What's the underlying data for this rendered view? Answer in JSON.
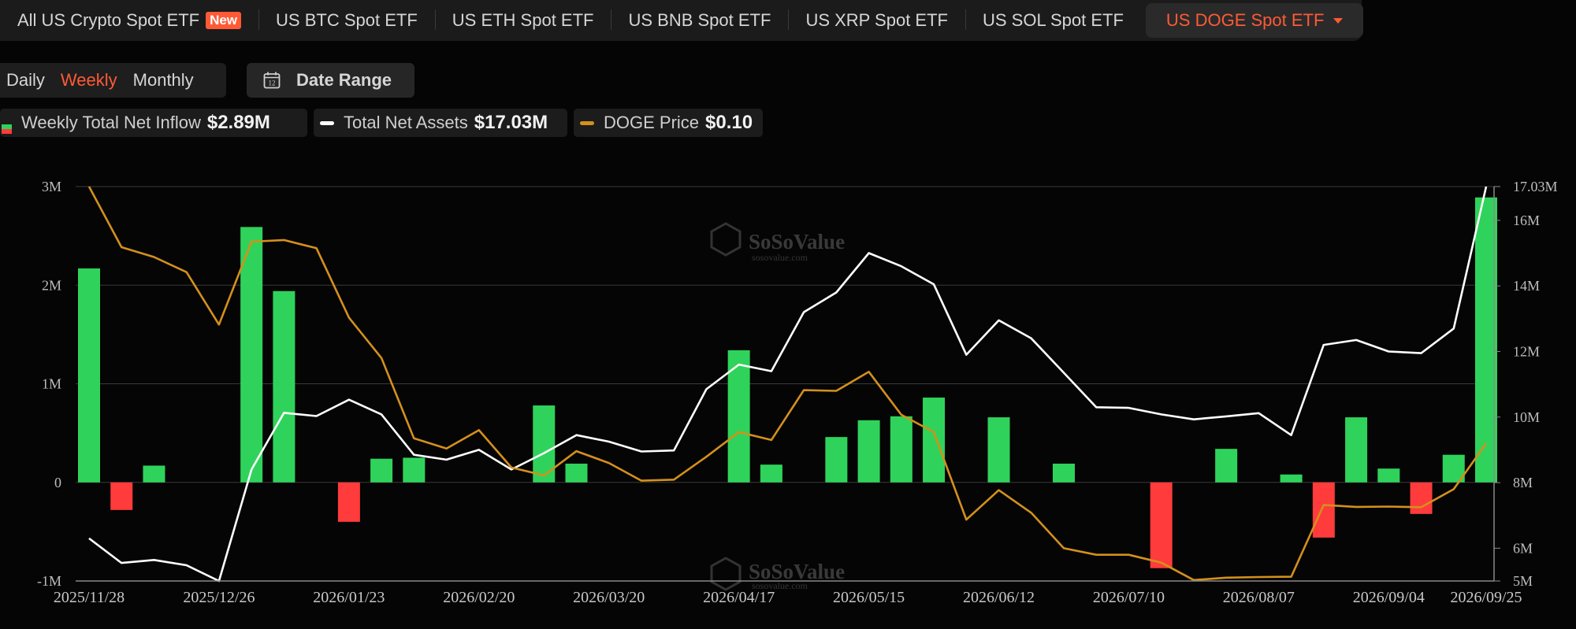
{
  "tabs": [
    {
      "label": "All US Crypto Spot ETF",
      "badge": "New"
    },
    {
      "label": "US BTC Spot ETF"
    },
    {
      "label": "US ETH Spot ETF"
    },
    {
      "label": "US BNB Spot ETF"
    },
    {
      "label": "US XRP Spot ETF"
    },
    {
      "label": "US SOL Spot ETF"
    },
    {
      "label": "US DOGE Spot ETF",
      "active": true
    }
  ],
  "period": {
    "daily": "Daily",
    "weekly": "Weekly",
    "monthly": "Monthly",
    "selected": "Weekly"
  },
  "date_range": {
    "label": "Date Range",
    "icon_text": "12"
  },
  "legend": {
    "inflow": {
      "label": "Weekly Total Net Inflow",
      "value": "$2.89M"
    },
    "assets": {
      "label": "Total Net Assets",
      "value": "$17.03M"
    },
    "price": {
      "label": "DOGE Price",
      "value": "$0.10"
    }
  },
  "watermark": {
    "brand": "SoSoValue",
    "url": "sosovalue.com"
  },
  "colors": {
    "positive": "#2fd35b",
    "negative": "#ff3b3b",
    "assets_line": "#ffffff",
    "price_line": "#d4901c",
    "accent": "#ff5a36"
  },
  "chart_data": {
    "type": "bar",
    "x_tick_labels": [
      "2025/11/28",
      "2025/12/26",
      "2026/01/23",
      "2026/02/20",
      "2026/03/20",
      "2026/04/17",
      "2026/05/15",
      "2026/06/12",
      "2026/07/10",
      "2026/08/07",
      "2026/09/04",
      "2026/09/25"
    ],
    "x": [
      "2025/11/28",
      "2025/12/05",
      "2025/12/12",
      "2025/12/19",
      "2025/12/26",
      "2026/01/02",
      "2026/01/09",
      "2026/01/16",
      "2026/01/23",
      "2026/01/30",
      "2026/02/06",
      "2026/02/13",
      "2026/02/20",
      "2026/02/27",
      "2026/03/06",
      "2026/03/13",
      "2026/03/20",
      "2026/03/27",
      "2026/04/03",
      "2026/04/10",
      "2026/04/17",
      "2026/04/24",
      "2026/05/01",
      "2026/05/08",
      "2026/05/15",
      "2026/05/22",
      "2026/05/29",
      "2026/06/05",
      "2026/06/12",
      "2026/06/19",
      "2026/06/26",
      "2026/07/03",
      "2026/07/10",
      "2026/07/17",
      "2026/07/24",
      "2026/07/31",
      "2026/08/07",
      "2026/08/14",
      "2026/08/21",
      "2026/08/28",
      "2026/09/04",
      "2026/09/11",
      "2026/09/18",
      "2026/09/25"
    ],
    "ylim_left": [
      -1000000,
      3000000
    ],
    "left_ticks": [
      {
        "v": 3000000,
        "label": "3M"
      },
      {
        "v": 2000000,
        "label": "2M"
      },
      {
        "v": 1000000,
        "label": "1M"
      },
      {
        "v": 0,
        "label": "0"
      },
      {
        "v": -1000000,
        "label": "-1M"
      }
    ],
    "ylim_right": [
      5000000,
      17030000
    ],
    "right_ticks": [
      {
        "v": 17030000,
        "label": "17.03M"
      },
      {
        "v": 16000000,
        "label": "16M"
      },
      {
        "v": 14000000,
        "label": "14M"
      },
      {
        "v": 12000000,
        "label": "12M"
      },
      {
        "v": 10000000,
        "label": "10M"
      },
      {
        "v": 8000000,
        "label": "8M"
      },
      {
        "v": 6000000,
        "label": "6M"
      },
      {
        "v": 5000000,
        "label": "5M"
      }
    ],
    "grid": true,
    "series": [
      {
        "name": "Weekly Total Net Inflow",
        "kind": "bar",
        "axis": "left",
        "values": [
          2170000,
          -280000,
          170000,
          0,
          0,
          2590000,
          1940000,
          0,
          -400000,
          240000,
          250000,
          0,
          0,
          0,
          780000,
          190000,
          0,
          0,
          0,
          0,
          1340000,
          180000,
          0,
          460000,
          630000,
          670000,
          860000,
          0,
          660000,
          0,
          190000,
          0,
          0,
          -870000,
          0,
          340000,
          0,
          80000,
          -560000,
          660000,
          140000,
          -320000,
          280000,
          2890000
        ]
      },
      {
        "name": "Total Net Assets",
        "kind": "line",
        "axis": "right",
        "values": [
          6300000,
          5550000,
          5640000,
          5480000,
          5000000,
          8400000,
          10130000,
          10030000,
          10530000,
          10080000,
          8850000,
          8700000,
          9000000,
          8400000,
          8900000,
          9450000,
          9250000,
          8950000,
          8980000,
          10850000,
          11600000,
          11400000,
          13200000,
          13800000,
          15000000,
          14600000,
          14050000,
          11900000,
          12950000,
          12400000,
          11350000,
          10300000,
          10280000,
          10080000,
          9930000,
          10020000,
          10120000,
          9450000,
          12200000,
          12350000,
          12000000,
          11950000,
          12700000,
          17030000
        ]
      },
      {
        "name": "DOGE Price",
        "kind": "line",
        "axis": "right",
        "values": [
          17030000,
          15180000,
          14880000,
          14420000,
          12820000,
          15350000,
          15400000,
          15150000,
          13030000,
          11800000,
          9350000,
          9040000,
          9600000,
          8460000,
          8220000,
          8960000,
          8600000,
          8060000,
          8090000,
          8790000,
          9540000,
          9300000,
          10820000,
          10800000,
          11380000,
          10070000,
          9540000,
          6870000,
          7770000,
          7080000,
          6000000,
          5800000,
          5800000,
          5560000,
          5030000,
          5100000,
          5120000,
          5130000,
          7320000,
          7260000,
          7270000,
          7250000,
          7800000,
          9200000
        ]
      }
    ]
  }
}
